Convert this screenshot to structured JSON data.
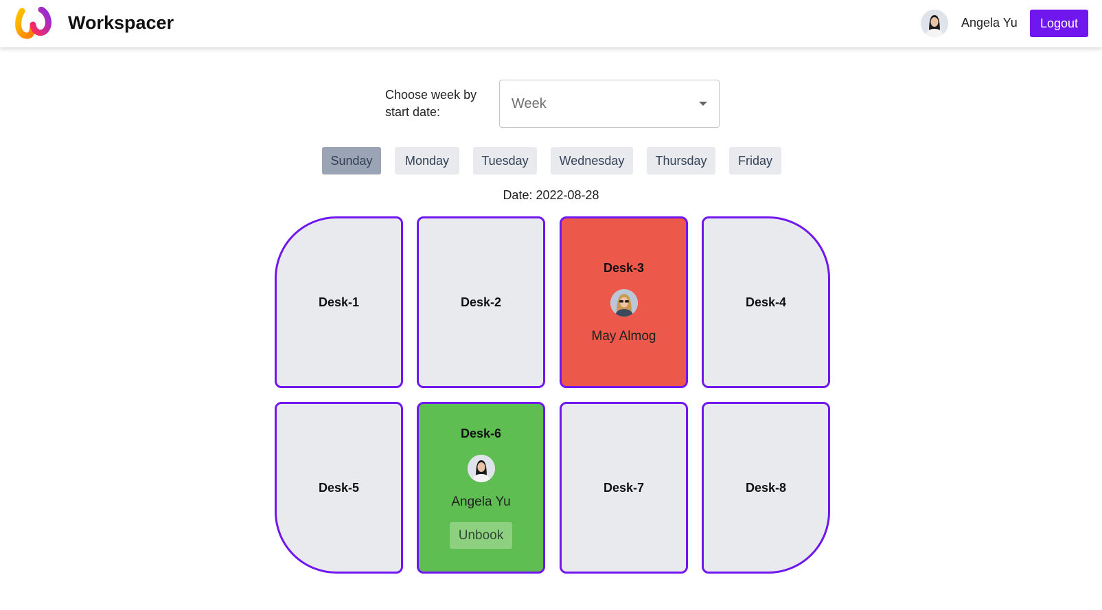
{
  "navbar": {
    "brand": "Workspacer",
    "user_name": "Angela Yu",
    "logout_label": "Logout"
  },
  "week_picker": {
    "label": "Choose week by start date:",
    "placeholder": "Week"
  },
  "days": [
    {
      "label": "Sunday",
      "active": true
    },
    {
      "label": "Monday",
      "active": false
    },
    {
      "label": "Tuesday",
      "active": false
    },
    {
      "label": "Wednesday",
      "active": false
    },
    {
      "label": "Thursday",
      "active": false
    },
    {
      "label": "Friday",
      "active": false
    }
  ],
  "date_line": "Date: 2022-08-28",
  "desks": [
    {
      "name": "Desk-1",
      "status": "available"
    },
    {
      "name": "Desk-2",
      "status": "available"
    },
    {
      "name": "Desk-3",
      "status": "booked",
      "user": "May Almog"
    },
    {
      "name": "Desk-4",
      "status": "available"
    },
    {
      "name": "Desk-5",
      "status": "available"
    },
    {
      "name": "Desk-6",
      "status": "booked-by-me",
      "user": "Angela Yu",
      "action_label": "Unbook"
    },
    {
      "name": "Desk-7",
      "status": "available"
    },
    {
      "name": "Desk-8",
      "status": "available"
    }
  ],
  "colors": {
    "accent": "#7016ef",
    "desk_available": "#e9eaee",
    "desk_booked_other": "#ec594a",
    "desk_booked_mine": "#5fbe51",
    "day_active": "#9aa4b5"
  }
}
